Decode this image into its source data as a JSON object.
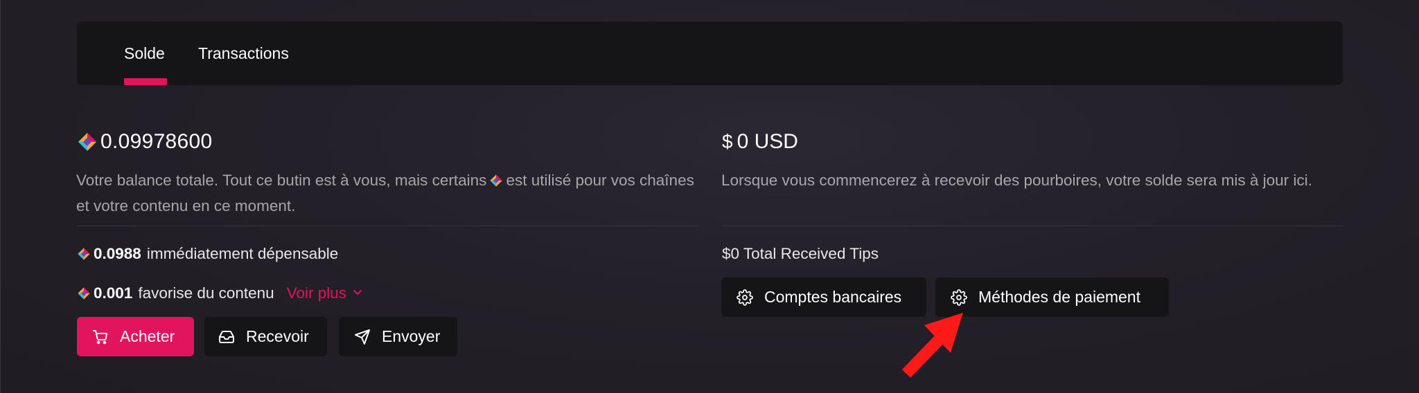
{
  "tabs": [
    {
      "label": "Solde",
      "active": true
    },
    {
      "label": "Transactions",
      "active": false
    }
  ],
  "balance": {
    "amount": "0.09978600",
    "description_part1": "Votre balance totale. Tout ce butin est à vous, mais certains",
    "description_part2": "est utilisé pour vos chaînes et votre contenu en ce moment.",
    "spendable_amount": "0.0988",
    "spendable_label": "immédiatement dépensable",
    "supporting_amount": "0.001",
    "supporting_label": "favorise du contenu",
    "see_more": "Voir plus"
  },
  "actions": {
    "buy": "Acheter",
    "receive": "Recevoir",
    "send": "Envoyer"
  },
  "tips": {
    "currency_symbol": "$",
    "amount": "0 USD",
    "description": "Lorsque vous commencerez à recevoir des pourboires, votre solde sera mis à jour ici.",
    "total_received": "$0 Total Received Tips",
    "bank_accounts": "Comptes bancaires",
    "payment_methods": "Méthodes de paiement"
  },
  "colors": {
    "accent": "#e2145e",
    "panel": "#151416",
    "annotation_arrow": "#ff1a1a"
  },
  "icons": [
    "credit-coin-icon",
    "cart-icon",
    "inbox-icon",
    "send-icon",
    "gear-icon",
    "chevron-down-icon",
    "dollar-icon"
  ]
}
